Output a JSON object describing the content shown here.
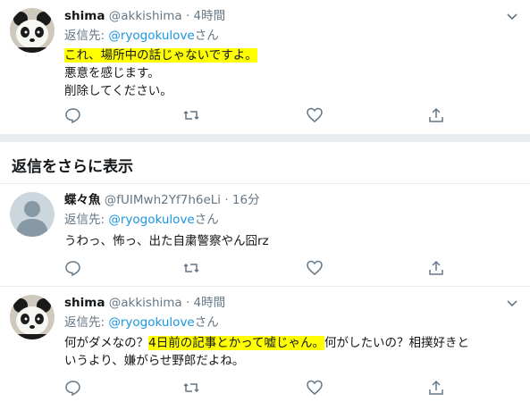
{
  "tweets": [
    {
      "name": "shima",
      "meta": "@akkishima · 4時間",
      "reply_prefix": "返信先: ",
      "reply_handle": "@ryogokulove",
      "reply_suffix": "さん",
      "lines": [
        "これ、場所中の話じゃないですよ。",
        "悪意を感じます。",
        "削除してください。"
      ]
    },
    {
      "name": "蝶々魚",
      "meta": "@fUIMwh2Yf7h6eLi · 16分",
      "reply_prefix": "返信先: ",
      "reply_handle": "@ryogokulove",
      "reply_suffix": "さん",
      "lines": [
        "うわっ、怖っ、出た自粛警察やん囧rz"
      ]
    },
    {
      "name": "shima",
      "meta": "@akkishima · 4時間",
      "reply_prefix": "返信先: ",
      "reply_handle": "@ryogokulove",
      "reply_suffix": "さん",
      "line1_pre": "何がダメなの？",
      "line1_hl": "4日前の記事とかって嘘じゃん。",
      "line1_post": "何がしたいの？相撲好きと",
      "line2": "いうより、嫌がらせ野郎だよね。"
    }
  ],
  "show_more_replies": "返信をさらに表示",
  "icons": [
    "reply-icon",
    "retweet-icon",
    "like-icon",
    "share-icon",
    "chevron-down-icon",
    "panda-avatar",
    "default-avatar"
  ],
  "colors": {
    "link": "#1b95e0",
    "meta": "#657786",
    "highlight": "#ffff00",
    "separator": "#e6ecf0"
  }
}
